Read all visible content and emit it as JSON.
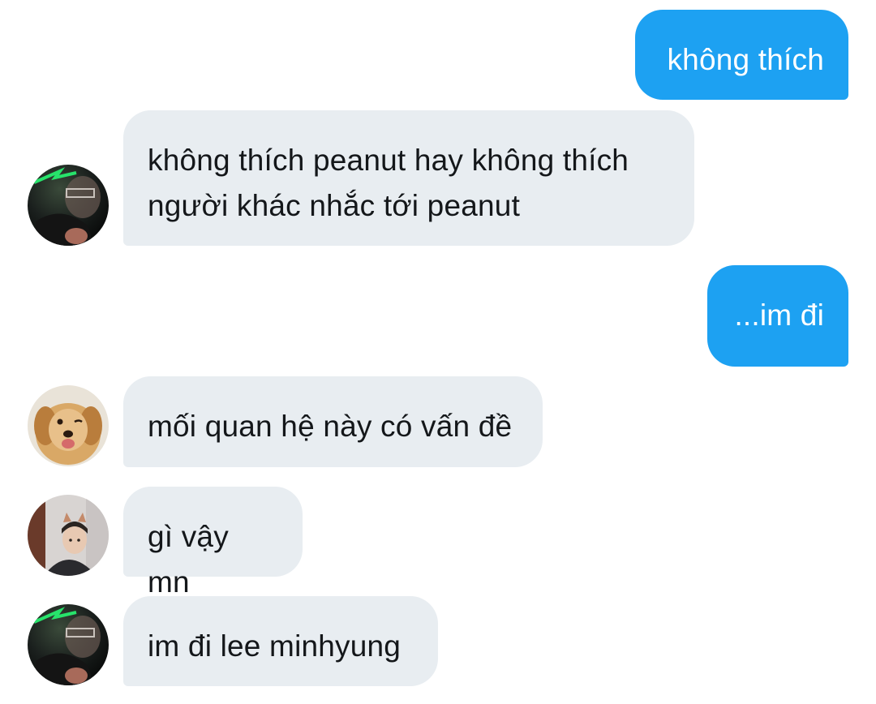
{
  "messages": [
    {
      "id": "m1",
      "direction": "sent",
      "text": "không thích"
    },
    {
      "id": "m2",
      "direction": "received",
      "avatar": "dark-green-light-avatar",
      "lines": [
        "không thích peanut hay không thích",
        "người khác nhắc tới peanut"
      ]
    },
    {
      "id": "m3",
      "direction": "sent",
      "text": "...im đi"
    },
    {
      "id": "m4",
      "direction": "received",
      "avatar": "golden-retriever-puppy-avatar",
      "text": "mối quan hệ này có vấn đề"
    },
    {
      "id": "m5",
      "direction": "received",
      "avatar": "boy-with-cat-ears-avatar",
      "text": "gì vậy mn"
    },
    {
      "id": "m6",
      "direction": "received",
      "avatar": "dark-green-light-avatar",
      "text": "im đi lee minhyung"
    }
  ],
  "colors": {
    "sent_bubble": "#1da1f2",
    "received_bubble": "#e8edf1",
    "sent_text": "#ffffff",
    "received_text": "#14171a"
  }
}
